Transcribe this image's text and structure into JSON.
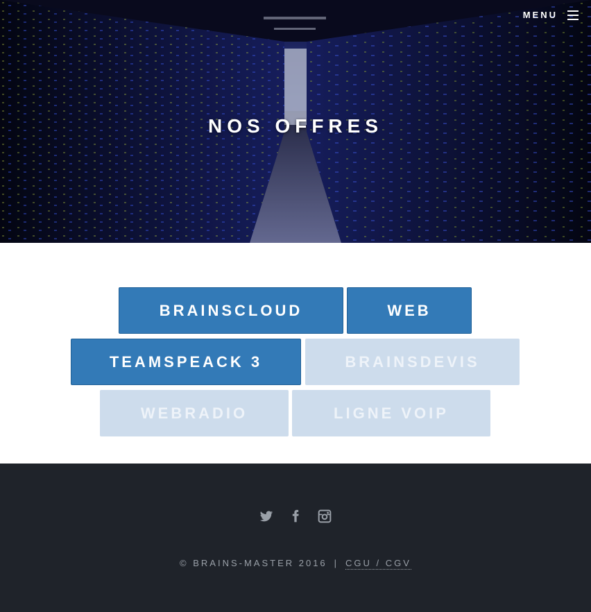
{
  "header": {
    "menu_label": "MENU",
    "title": "NOS OFFRES"
  },
  "offers": [
    {
      "label": "BRAINSCLOUD",
      "state": "active"
    },
    {
      "label": "WEB",
      "state": "active"
    },
    {
      "label": "TEAMSPEACK 3",
      "state": "active"
    },
    {
      "label": "BRAINSDEVIS",
      "state": "muted"
    },
    {
      "label": "WEBRADIO",
      "state": "muted"
    },
    {
      "label": "LIGNE VOIP",
      "state": "muted"
    }
  ],
  "footer": {
    "social": [
      "twitter-icon",
      "facebook-icon",
      "instagram-icon"
    ],
    "copyright": "© BRAINS-MASTER 2016",
    "separator": "|",
    "terms_link": "CGU / CGV"
  },
  "colors": {
    "accent": "#337ab7",
    "muted": "#cddcec",
    "footer_bg": "#1f232a"
  }
}
